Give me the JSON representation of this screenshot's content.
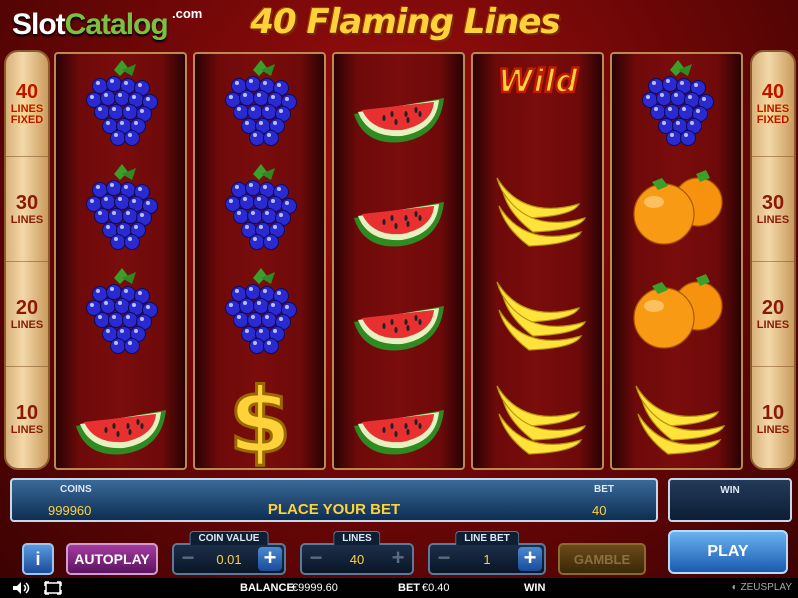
{
  "branding": {
    "site_slot": "Slot",
    "site_catalog": "Catalog",
    "site_com": ".com",
    "game_title": "40 Flaming Lines"
  },
  "line_selector": {
    "left": [
      {
        "num": "40",
        "label": "LINES",
        "extra": "FIXED",
        "active": true
      },
      {
        "num": "30",
        "label": "LINES",
        "extra": "",
        "active": false
      },
      {
        "num": "20",
        "label": "LINES",
        "extra": "",
        "active": false
      },
      {
        "num": "10",
        "label": "LINES",
        "extra": "",
        "active": false
      }
    ],
    "right": [
      {
        "num": "40",
        "label": "LINES",
        "extra": "FIXED",
        "active": true
      },
      {
        "num": "30",
        "label": "LINES",
        "extra": "",
        "active": false
      },
      {
        "num": "20",
        "label": "LINES",
        "extra": "",
        "active": false
      },
      {
        "num": "10",
        "label": "LINES",
        "extra": "",
        "active": false
      }
    ]
  },
  "reels": [
    [
      "grapes",
      "grapes",
      "grapes",
      "watermelon"
    ],
    [
      "grapes",
      "grapes",
      "grapes",
      "dollar"
    ],
    [
      "watermelon",
      "watermelon",
      "watermelon",
      "watermelon"
    ],
    [
      "wild",
      "banana",
      "banana",
      "banana"
    ],
    [
      "grapes",
      "orange",
      "orange",
      "banana"
    ]
  ],
  "wild_text": "Wild",
  "info_bar": {
    "coins_label": "COINS",
    "coins_value": "999960",
    "message": "PLACE YOUR BET",
    "bet_label": "BET",
    "bet_value": "40"
  },
  "win_box": {
    "label": "WIN"
  },
  "controls": {
    "info_label": "i",
    "autoplay_label": "AUTOPLAY",
    "coin_value": {
      "caption": "COIN VALUE",
      "value": "0.01",
      "minus": "−",
      "plus": "+"
    },
    "lines": {
      "caption": "LINES",
      "value": "40",
      "minus": "−",
      "plus": "+"
    },
    "line_bet": {
      "caption": "LINE BET",
      "value": "1",
      "minus": "−",
      "plus": "+"
    },
    "gamble_label": "GAMBLE",
    "play_label": "PLAY"
  },
  "footer": {
    "balance_label": "BALANCE",
    "balance_value": "€9999.60",
    "bet_label": "BET",
    "bet_value": "€0.40",
    "win_label": "WIN",
    "provider": "ZEUSPLAY"
  },
  "colors": {
    "background": "#7a0c0c",
    "title": "#ffd23a",
    "info_bar": "#0e2e52",
    "play_button": "#1a5ab0",
    "autoplay_button": "#5a1460"
  }
}
